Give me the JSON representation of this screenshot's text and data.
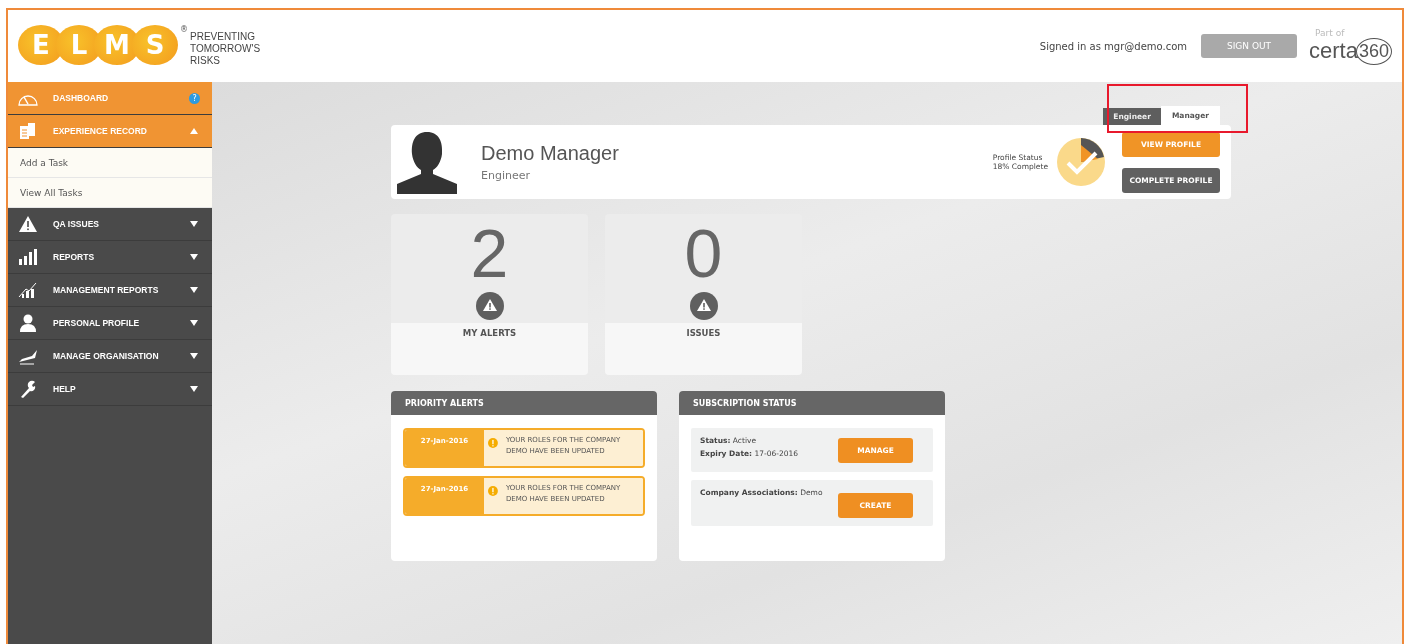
{
  "header": {
    "logo_letters": [
      "E",
      "L",
      "M",
      "S"
    ],
    "registered": "®",
    "tagline": "PREVENTING TOMORROW'S RISKS",
    "signed_in": "Signed in as mgr@demo.com",
    "sign_out": "SIGN OUT",
    "partner_prefix": "Part of",
    "partner_name": "certa",
    "partner_number": "360"
  },
  "sidebar": {
    "items": [
      {
        "kind": "dashboard",
        "label": "DASHBOARD",
        "selected": true,
        "help": "?"
      },
      {
        "kind": "record",
        "label": "EXPERIENCE RECORD",
        "selected": true,
        "expanded": true,
        "children": [
          {
            "label": "Add a Task"
          },
          {
            "label": "View All Tasks"
          }
        ]
      },
      {
        "kind": "warning",
        "label": "QA ISSUES",
        "selected": false,
        "expanded": false
      },
      {
        "kind": "bars",
        "label": "REPORTS",
        "selected": false,
        "expanded": false
      },
      {
        "kind": "trend",
        "label": "MANAGEMENT REPORTS",
        "selected": false,
        "expanded": false
      },
      {
        "kind": "person",
        "label": "PERSONAL PROFILE",
        "selected": false,
        "expanded": false
      },
      {
        "kind": "plane",
        "label": "MANAGE ORGANISATION",
        "selected": false,
        "expanded": false
      },
      {
        "kind": "wrench",
        "label": "HELP",
        "selected": false,
        "expanded": false
      }
    ]
  },
  "role_tabs": [
    {
      "label": "Engineer",
      "selected": false
    },
    {
      "label": "Manager",
      "selected": true
    }
  ],
  "profile": {
    "name": "Demo Manager",
    "role": "Engineer",
    "status_label": "Profile Status",
    "status_value": "18% Complete",
    "buttons": [
      {
        "label": "VIEW PROFILE",
        "kind": "primary"
      },
      {
        "label": "COMPLETE PROFILE",
        "kind": "secondary"
      }
    ]
  },
  "stats": [
    {
      "value": "2",
      "label": "MY ALERTS"
    },
    {
      "value": "0",
      "label": "ISSUES"
    }
  ],
  "priority_alerts": {
    "title": "PRIORITY ALERTS",
    "items": [
      {
        "date": "27-Jan-2016",
        "message": "YOUR ROLES FOR THE COMPANY DEMO HAVE BEEN UPDATED"
      },
      {
        "date": "27-Jan-2016",
        "message": "YOUR ROLES FOR THE COMPANY DEMO HAVE BEEN UPDATED"
      }
    ]
  },
  "subscription": {
    "title": "SUBSCRIPTION STATUS",
    "blocks": [
      {
        "lines": [
          "**Status:** Active",
          "**Expiry Date:** 17-06-2016"
        ],
        "button": "MANAGE"
      },
      {
        "lines": [
          "**Company Associations:** Demo"
        ],
        "button": "CREATE"
      }
    ]
  }
}
